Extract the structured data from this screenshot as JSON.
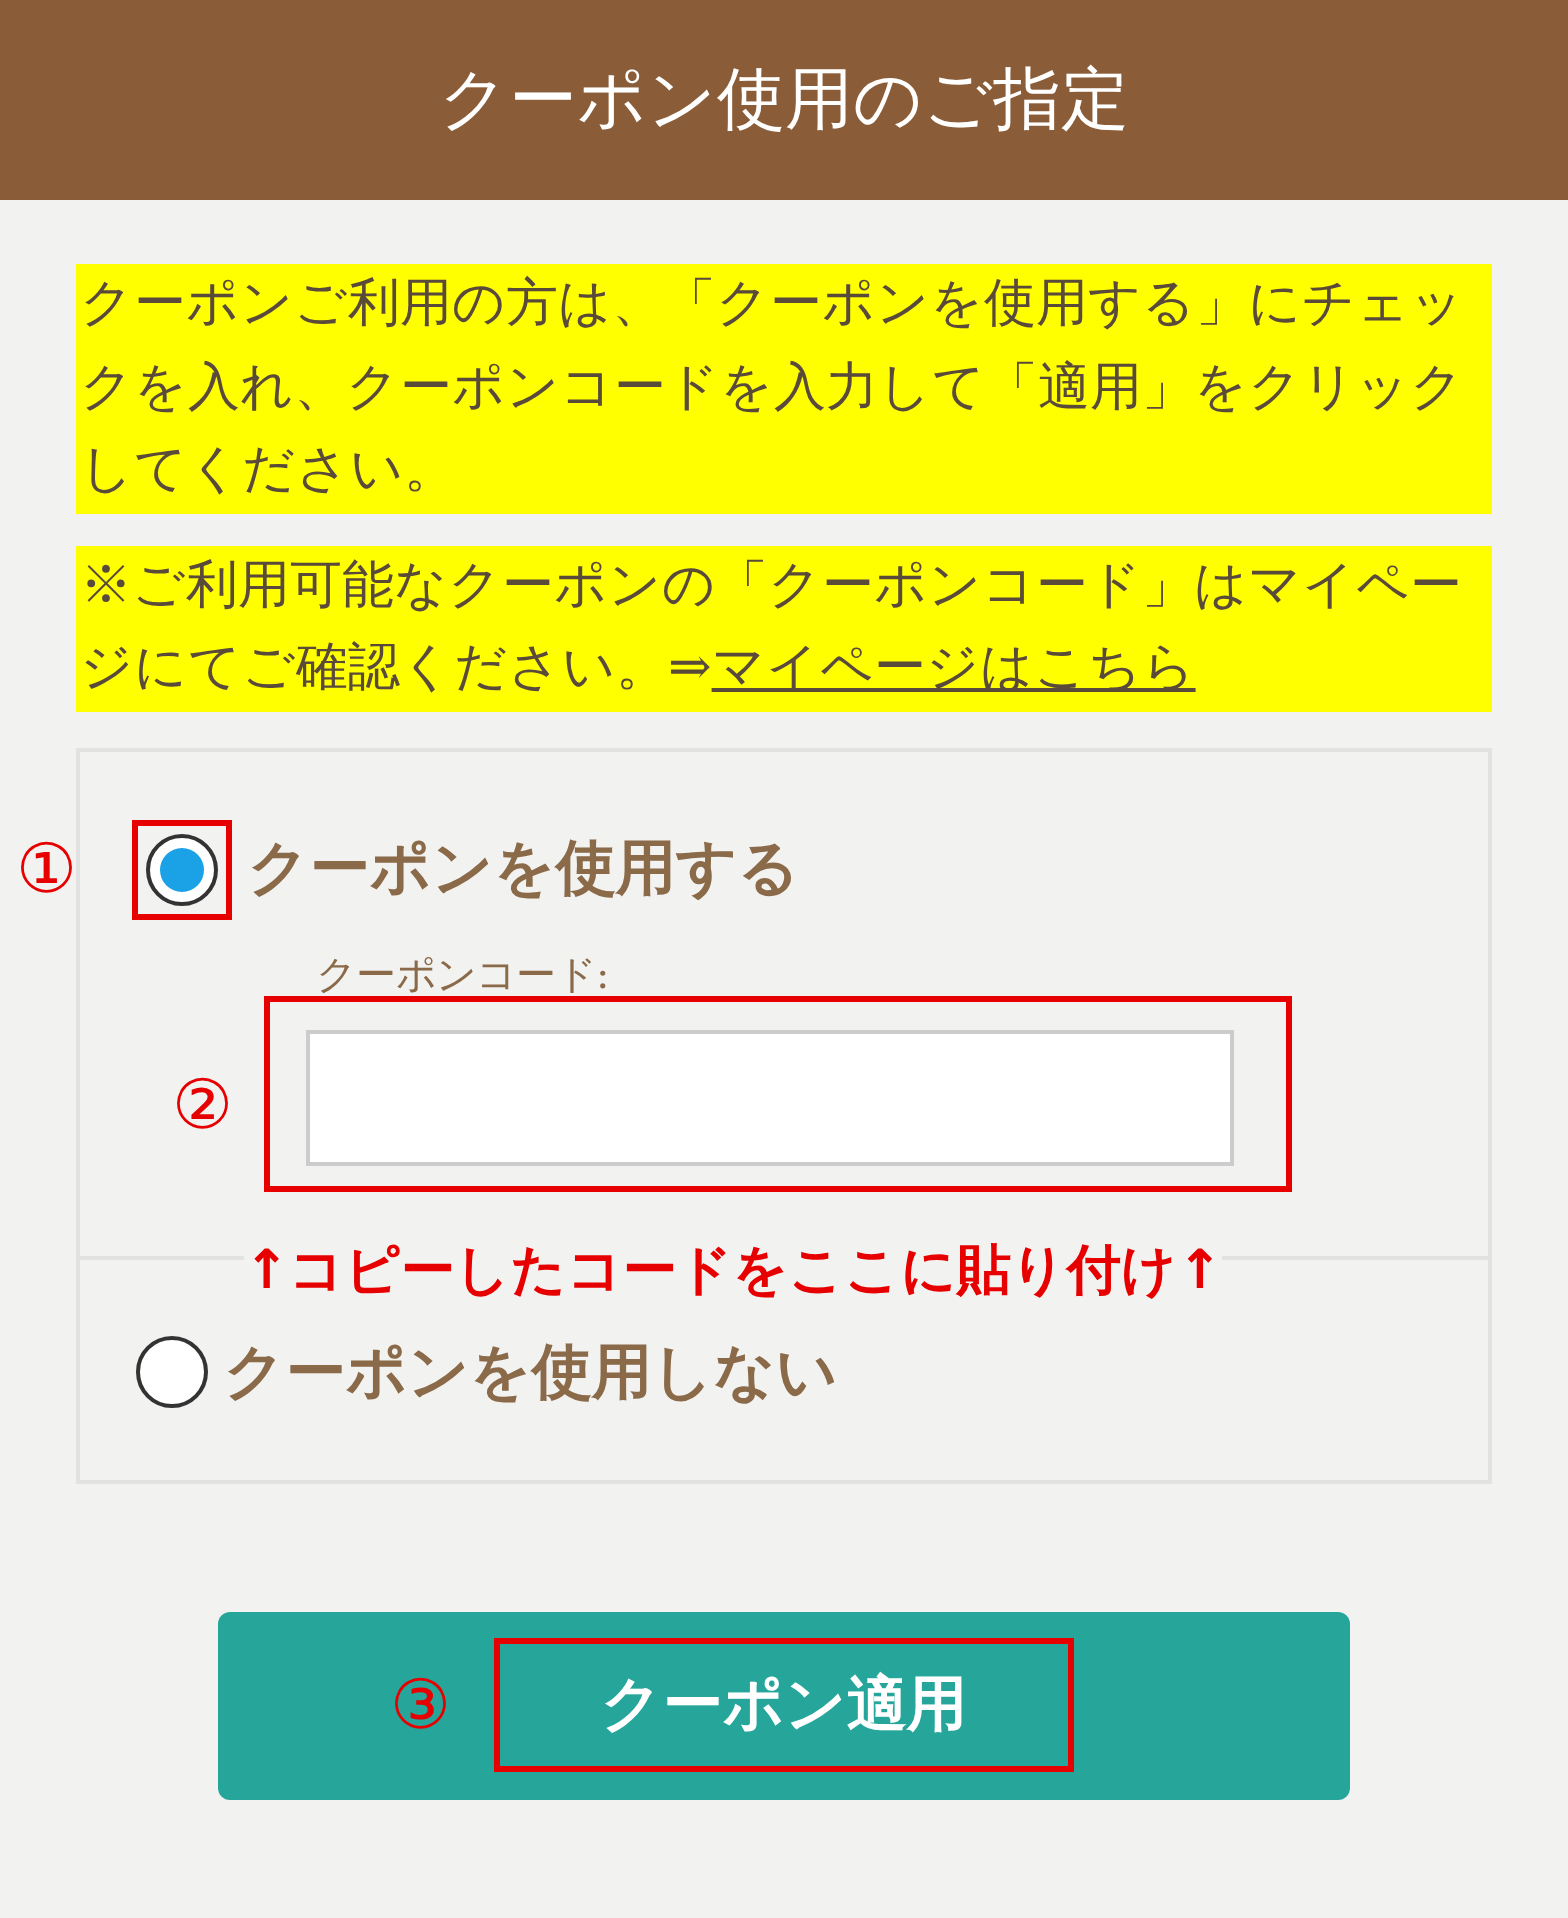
{
  "header": {
    "title": "クーポン使用のご指定"
  },
  "notices": [
    {
      "text": "クーポンご利用の方は、「クーポンを使用する」にチェックを入れ、クーポンコードを入力して「適用」をクリックしてください。"
    },
    {
      "text": "※ご利用可能なクーポンの「クーポンコード」はマイページにてご確認ください。⇒",
      "link": "マイページはこちら"
    }
  ],
  "options": [
    {
      "label": "クーポンを使用する",
      "selected": true,
      "marker": "①"
    },
    {
      "label": "クーポンを使用しない",
      "selected": false
    }
  ],
  "code_field": {
    "label": "クーポンコード:",
    "marker": "②"
  },
  "hint": "↑コピーしたコードをここに貼り付け↑",
  "apply_button": {
    "label": "クーポン適用",
    "marker": "③"
  }
}
